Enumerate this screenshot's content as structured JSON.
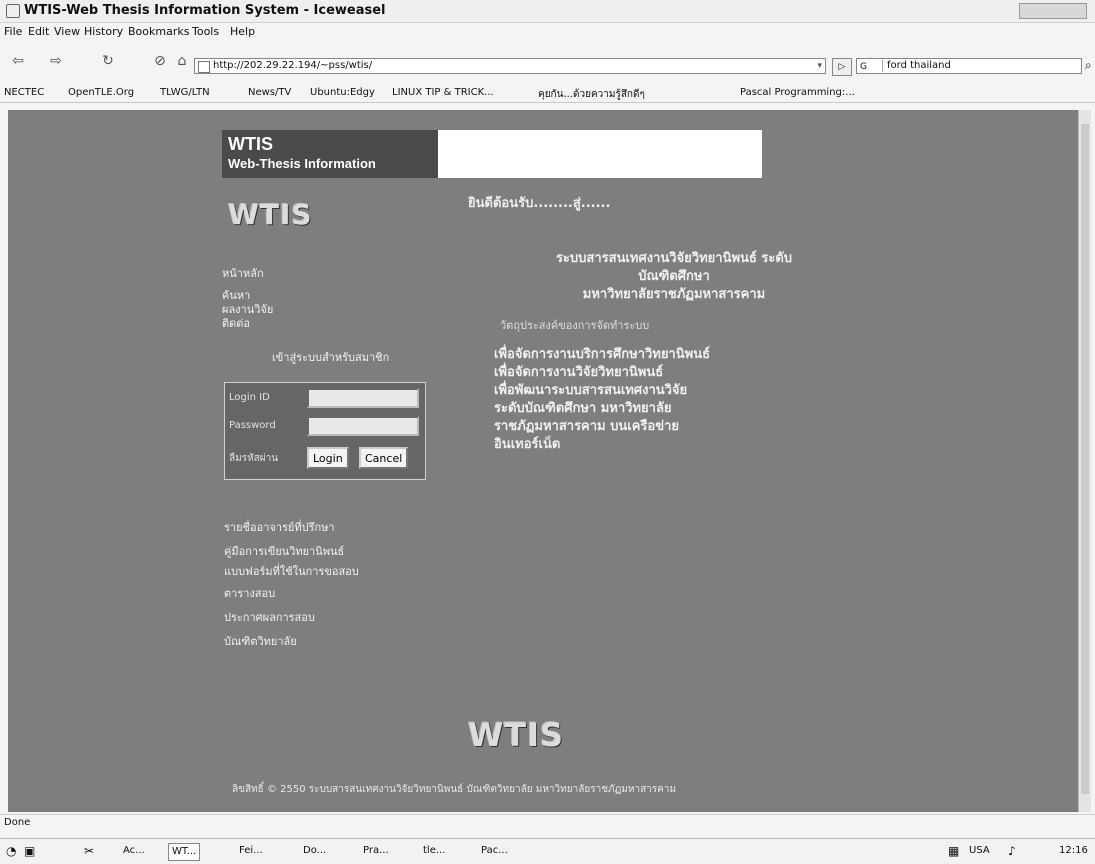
{
  "window": {
    "title": "WTIS-Web Thesis Information System - Iceweasel"
  },
  "menu": [
    "File",
    "Edit",
    "View",
    "History",
    "Bookmarks",
    "Tools",
    "Help"
  ],
  "nav": {
    "url": "http://202.29.22.194/~pss/wtis/",
    "search_engine": "G",
    "search_value": "ford thailand"
  },
  "bookmarks": [
    "NECTEC",
    "OpenTLE.Org",
    "TLWG/LTN",
    "News/TV",
    "Ubuntu:Edgy",
    "LINUX TIP & TRICK...",
    "คุยกัน...ด้วยความรู้สึกดีๆ",
    "Pascal Programming:..."
  ],
  "page": {
    "banner_line1": "WTIS",
    "banner_line2": "Web-Thesis Information",
    "logo_side": "WTIS",
    "welcome": "ยินดีต้อนรับ........สู่......",
    "intro_lines": [
      "ระบบสารสนเทศงานวิจัยวิทยานิพนธ์ ระดับ",
      "บัณฑิตศึกษา",
      "มหาวิทยาลัยราชภัฏมหาสารคาม"
    ],
    "objective_heading": "วัตถุประสงค์ของการจัดทำระบบ",
    "objective_lines": [
      "เพื่อจัดการงานบริการศึกษาวิทยานิพนธ์",
      "เพื่อจัดการงานวิจัยวิทยานิพนธ์",
      "เพื่อพัฒนาระบบสารสนเทศงานวิจัย",
      "ระดับบัณฑิตศึกษา มหาวิทยาลัย",
      "ราชภัฏมหาสารคาม บนเครือข่าย",
      "อินเทอร์เน็ต"
    ],
    "side_items": [
      "หน้าหลัก",
      "ค้นหา",
      "ผลงานวิจัย",
      "ติดต่อ"
    ],
    "side_caption": "เข้าสู่ระบบสำหรับสมาชิก",
    "login": {
      "user_label": "Login ID",
      "pass_label": "Password",
      "extra_label": "ลืมรหัสผ่าน",
      "login_button": "Login",
      "cancel_button": "Cancel"
    },
    "links": [
      "รายชื่ออาจารย์ที่ปรึกษา",
      "คู่มือการเขียนวิทยานิพนธ์",
      "แบบฟอร์มที่ใช้ในการขอสอบ",
      "ตารางสอบ",
      "ประกาศผลการสอบ",
      "บัณฑิตวิทยาลัย"
    ],
    "logo_bottom": "WTIS",
    "footer": "ลิขสิทธิ์ © 2550 ระบบสารสนเทศงานวิจัยวิทยานิพนธ์ บัณฑิตวิทยาลัย มหาวิทยาลัยราชภัฏมหาสารคาม"
  },
  "status": "Done",
  "taskbar": {
    "items": [
      "Ac...",
      "WT...",
      "Fei...",
      "Do...",
      "Pra...",
      "tle...",
      "Pac..."
    ],
    "keyboard": "USA",
    "clock": "12:16"
  }
}
